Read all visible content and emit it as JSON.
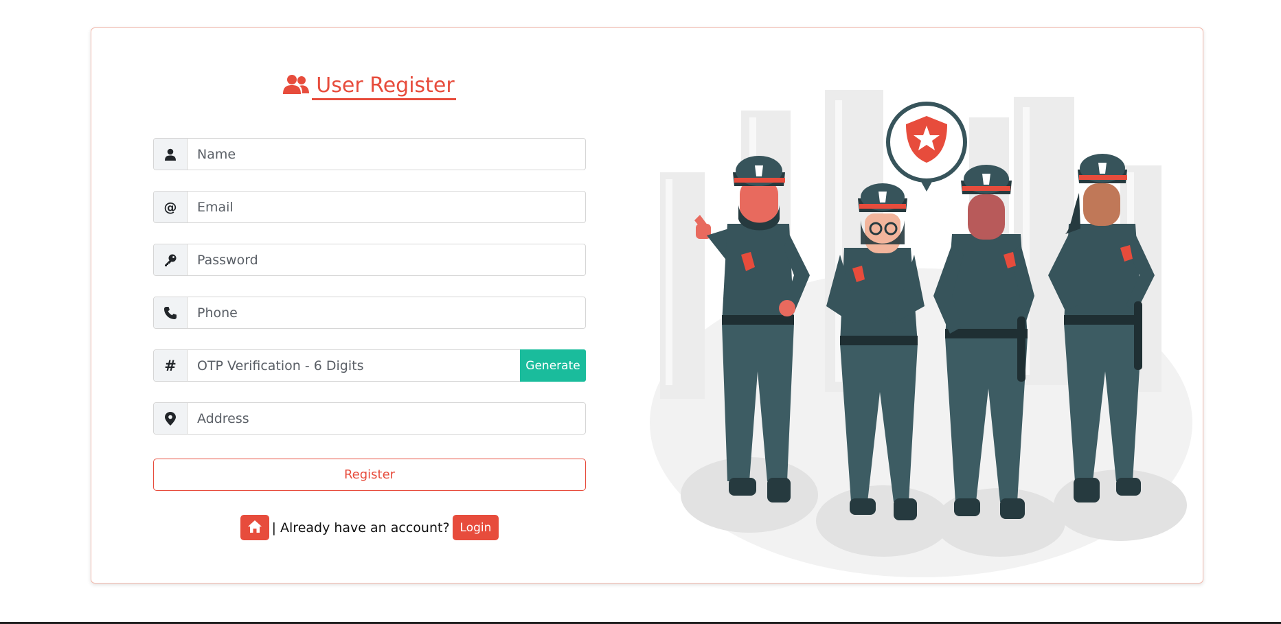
{
  "form": {
    "title": "User Register",
    "fields": [
      {
        "name": "name",
        "placeholder": "Name",
        "icon": "user-icon"
      },
      {
        "name": "email",
        "placeholder": "Email",
        "icon": "at-icon"
      },
      {
        "name": "password",
        "placeholder": "Password",
        "icon": "key-icon"
      },
      {
        "name": "phone",
        "placeholder": "Phone",
        "icon": "phone-icon"
      },
      {
        "name": "otp",
        "placeholder": "OTP Verification - 6 Digits",
        "icon": "hash-icon"
      },
      {
        "name": "address",
        "placeholder": "Address",
        "icon": "map-pin-icon"
      }
    ],
    "generate_label": "Generate",
    "register_label": "Register",
    "account_text": "| Already have an account?",
    "login_label": "Login"
  },
  "colors": {
    "accent": "#e74c3c",
    "generate": "#1abc9c",
    "uniform": "#37545b",
    "card_border": "#f2b8ab"
  }
}
